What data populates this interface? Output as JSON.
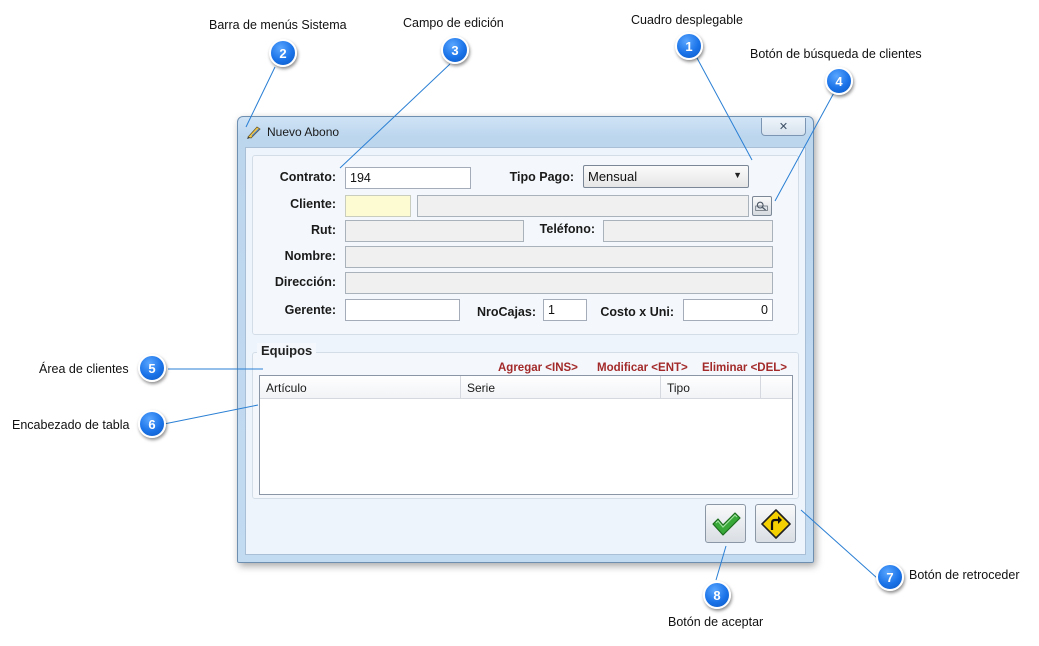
{
  "window": {
    "title": "Nuevo Abono",
    "close_glyph": "✕"
  },
  "form": {
    "contrato_label": "Contrato:",
    "contrato_value": "194",
    "tipo_pago_label": "Tipo Pago:",
    "tipo_pago_selected": "Mensual",
    "cliente_label": "Cliente:",
    "cliente_code_value": "",
    "cliente_name_value": "",
    "rut_label": "Rut:",
    "rut_value": "",
    "telefono_label": "Teléfono:",
    "telefono_value": "",
    "nombre_label": "Nombre:",
    "nombre_value": "",
    "direccion_label": "Dirección:",
    "direccion_value": "",
    "gerente_label": "Gerente:",
    "gerente_value": "",
    "nrocajas_label": "NroCajas:",
    "nrocajas_value": "1",
    "costo_label": "Costo x Uni:",
    "costo_value": "0"
  },
  "equipos": {
    "legend": "Equipos",
    "agregar": "Agregar <INS>",
    "modificar": "Modificar <ENT>",
    "eliminar": "Eliminar <DEL>",
    "columns": [
      "Artículo",
      "Serie",
      "Tipo"
    ]
  },
  "callouts": [
    {
      "number": "1",
      "label": "Cuadro desplegable"
    },
    {
      "number": "2",
      "label": "Barra de menús Sistema"
    },
    {
      "number": "3",
      "label": "Campo de edición"
    },
    {
      "number": "4",
      "label": "Botón de búsqueda de clientes"
    },
    {
      "number": "5",
      "label": "Área de clientes"
    },
    {
      "number": "6",
      "label": "Encabezado de tabla"
    },
    {
      "number": "7",
      "label": "Botón de retroceder"
    },
    {
      "number": "8",
      "label": "Botón de aceptar"
    }
  ],
  "icons": {
    "window": "pencil-icon",
    "search": "search-icon",
    "accept": "check-icon",
    "back": "back-arrow-icon",
    "dropdown": "chevron-down-icon"
  },
  "colors": {
    "badge": "#1a73e8",
    "action_text": "#a32a2a",
    "accept_check": "#2ea02e",
    "back_sign": "#f5d000"
  }
}
